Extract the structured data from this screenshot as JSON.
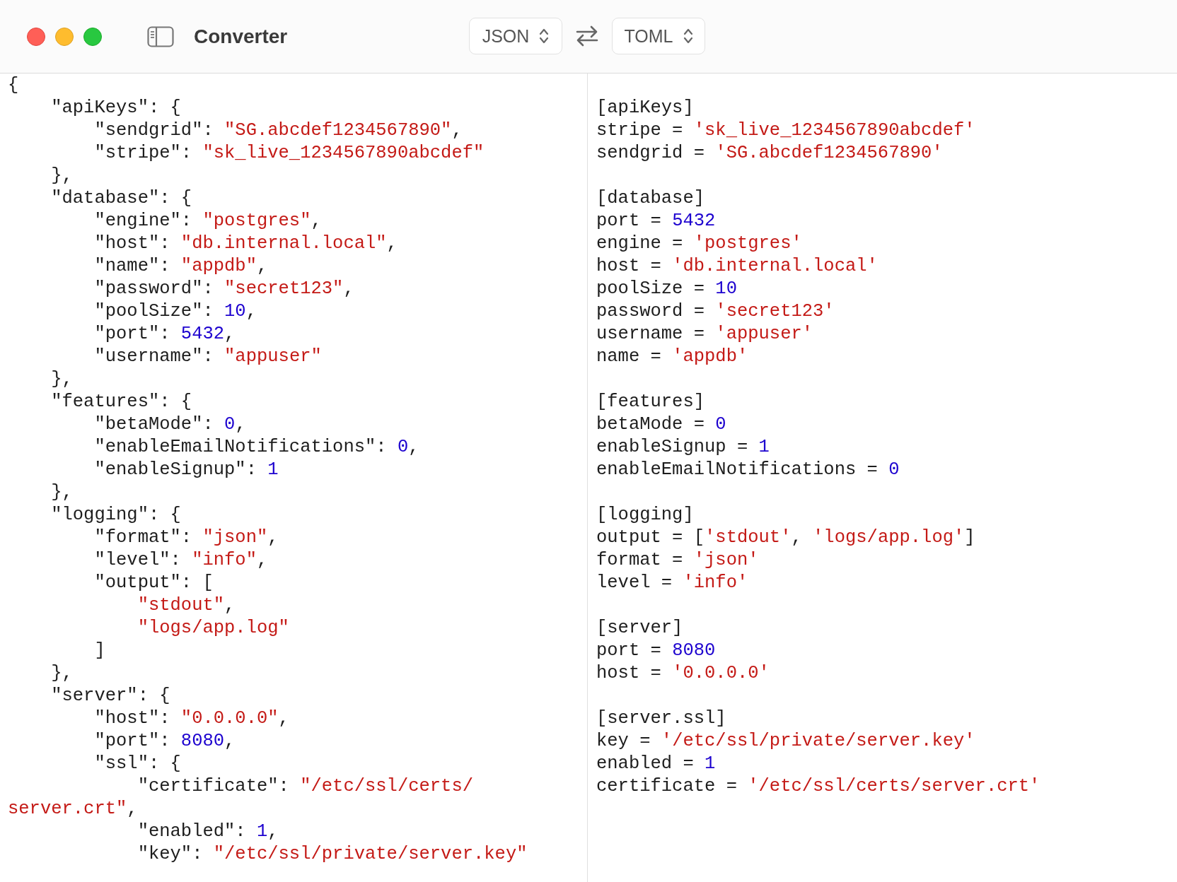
{
  "window": {
    "title": "Converter"
  },
  "toolbar": {
    "source_format": "JSON",
    "target_format": "TOML"
  },
  "input_lines": [
    [
      {
        "kind": "text",
        "text": "{"
      }
    ],
    [
      {
        "kind": "text",
        "text": "    \"apiKeys\": {"
      }
    ],
    [
      {
        "kind": "text",
        "text": "        \"sendgrid\": "
      },
      {
        "kind": "string",
        "text": "\"SG.abcdef1234567890\""
      },
      {
        "kind": "text",
        "text": ","
      }
    ],
    [
      {
        "kind": "text",
        "text": "        \"stripe\": "
      },
      {
        "kind": "string",
        "text": "\"sk_live_1234567890abcdef\""
      }
    ],
    [
      {
        "kind": "text",
        "text": "    },"
      }
    ],
    [
      {
        "kind": "text",
        "text": "    \"database\": {"
      }
    ],
    [
      {
        "kind": "text",
        "text": "        \"engine\": "
      },
      {
        "kind": "string",
        "text": "\"postgres\""
      },
      {
        "kind": "text",
        "text": ","
      }
    ],
    [
      {
        "kind": "text",
        "text": "        \"host\": "
      },
      {
        "kind": "string",
        "text": "\"db.internal.local\""
      },
      {
        "kind": "text",
        "text": ","
      }
    ],
    [
      {
        "kind": "text",
        "text": "        \"name\": "
      },
      {
        "kind": "string",
        "text": "\"appdb\""
      },
      {
        "kind": "text",
        "text": ","
      }
    ],
    [
      {
        "kind": "text",
        "text": "        \"password\": "
      },
      {
        "kind": "string",
        "text": "\"secret123\""
      },
      {
        "kind": "text",
        "text": ","
      }
    ],
    [
      {
        "kind": "text",
        "text": "        \"poolSize\": "
      },
      {
        "kind": "number",
        "text": "10"
      },
      {
        "kind": "text",
        "text": ","
      }
    ],
    [
      {
        "kind": "text",
        "text": "        \"port\": "
      },
      {
        "kind": "number",
        "text": "5432"
      },
      {
        "kind": "text",
        "text": ","
      }
    ],
    [
      {
        "kind": "text",
        "text": "        \"username\": "
      },
      {
        "kind": "string",
        "text": "\"appuser\""
      }
    ],
    [
      {
        "kind": "text",
        "text": "    },"
      }
    ],
    [
      {
        "kind": "text",
        "text": "    \"features\": {"
      }
    ],
    [
      {
        "kind": "text",
        "text": "        \"betaMode\": "
      },
      {
        "kind": "number",
        "text": "0"
      },
      {
        "kind": "text",
        "text": ","
      }
    ],
    [
      {
        "kind": "text",
        "text": "        \"enableEmailNotifications\": "
      },
      {
        "kind": "number",
        "text": "0"
      },
      {
        "kind": "text",
        "text": ","
      }
    ],
    [
      {
        "kind": "text",
        "text": "        \"enableSignup\": "
      },
      {
        "kind": "number",
        "text": "1"
      }
    ],
    [
      {
        "kind": "text",
        "text": "    },"
      }
    ],
    [
      {
        "kind": "text",
        "text": "    \"logging\": {"
      }
    ],
    [
      {
        "kind": "text",
        "text": "        \"format\": "
      },
      {
        "kind": "string",
        "text": "\"json\""
      },
      {
        "kind": "text",
        "text": ","
      }
    ],
    [
      {
        "kind": "text",
        "text": "        \"level\": "
      },
      {
        "kind": "string",
        "text": "\"info\""
      },
      {
        "kind": "text",
        "text": ","
      }
    ],
    [
      {
        "kind": "text",
        "text": "        \"output\": ["
      }
    ],
    [
      {
        "kind": "string",
        "text": "            \"stdout\""
      },
      {
        "kind": "text",
        "text": ","
      }
    ],
    [
      {
        "kind": "string",
        "text": "            \"logs/app.log\""
      }
    ],
    [
      {
        "kind": "text",
        "text": "        ]"
      }
    ],
    [
      {
        "kind": "text",
        "text": "    },"
      }
    ],
    [
      {
        "kind": "text",
        "text": "    \"server\": {"
      }
    ],
    [
      {
        "kind": "text",
        "text": "        \"host\": "
      },
      {
        "kind": "string",
        "text": "\"0.0.0.0\""
      },
      {
        "kind": "text",
        "text": ","
      }
    ],
    [
      {
        "kind": "text",
        "text": "        \"port\": "
      },
      {
        "kind": "number",
        "text": "8080"
      },
      {
        "kind": "text",
        "text": ","
      }
    ],
    [
      {
        "kind": "text",
        "text": "        \"ssl\": {"
      }
    ],
    [
      {
        "kind": "text",
        "text": "            \"certificate\": "
      },
      {
        "kind": "string",
        "text": "\"/etc/ssl/certs/"
      }
    ],
    [
      {
        "kind": "string",
        "text": "server.crt\""
      },
      {
        "kind": "text",
        "text": ","
      }
    ],
    [
      {
        "kind": "text",
        "text": "            \"enabled\": "
      },
      {
        "kind": "number",
        "text": "1"
      },
      {
        "kind": "text",
        "text": ","
      }
    ],
    [
      {
        "kind": "text",
        "text": "            \"key\": "
      },
      {
        "kind": "string",
        "text": "\"/etc/ssl/private/server.key\""
      }
    ]
  ],
  "output_sections": [
    {
      "header": "[apiKeys]",
      "lines": [
        [
          {
            "kind": "text",
            "text": "stripe = "
          },
          {
            "kind": "string",
            "text": "'sk_live_1234567890abcdef'"
          }
        ],
        [
          {
            "kind": "text",
            "text": "sendgrid = "
          },
          {
            "kind": "string",
            "text": "'SG.abcdef1234567890'"
          }
        ]
      ]
    },
    {
      "header": "[database]",
      "lines": [
        [
          {
            "kind": "text",
            "text": "port = "
          },
          {
            "kind": "number",
            "text": "5432"
          }
        ],
        [
          {
            "kind": "text",
            "text": "engine = "
          },
          {
            "kind": "string",
            "text": "'postgres'"
          }
        ],
        [
          {
            "kind": "text",
            "text": "host = "
          },
          {
            "kind": "string",
            "text": "'db.internal.local'"
          }
        ],
        [
          {
            "kind": "text",
            "text": "poolSize = "
          },
          {
            "kind": "number",
            "text": "10"
          }
        ],
        [
          {
            "kind": "text",
            "text": "password = "
          },
          {
            "kind": "string",
            "text": "'secret123'"
          }
        ],
        [
          {
            "kind": "text",
            "text": "username = "
          },
          {
            "kind": "string",
            "text": "'appuser'"
          }
        ],
        [
          {
            "kind": "text",
            "text": "name = "
          },
          {
            "kind": "string",
            "text": "'appdb'"
          }
        ]
      ]
    },
    {
      "header": "[features]",
      "lines": [
        [
          {
            "kind": "text",
            "text": "betaMode = "
          },
          {
            "kind": "number",
            "text": "0"
          }
        ],
        [
          {
            "kind": "text",
            "text": "enableSignup = "
          },
          {
            "kind": "number",
            "text": "1"
          }
        ],
        [
          {
            "kind": "text",
            "text": "enableEmailNotifications = "
          },
          {
            "kind": "number",
            "text": "0"
          }
        ]
      ]
    },
    {
      "header": "[logging]",
      "lines": [
        [
          {
            "kind": "text",
            "text": "output = ["
          },
          {
            "kind": "string",
            "text": "'stdout'"
          },
          {
            "kind": "text",
            "text": ", "
          },
          {
            "kind": "string",
            "text": "'logs/app.log'"
          },
          {
            "kind": "text",
            "text": "]"
          }
        ],
        [
          {
            "kind": "text",
            "text": "format = "
          },
          {
            "kind": "string",
            "text": "'json'"
          }
        ],
        [
          {
            "kind": "text",
            "text": "level = "
          },
          {
            "kind": "string",
            "text": "'info'"
          }
        ]
      ]
    },
    {
      "header": "[server]",
      "lines": [
        [
          {
            "kind": "text",
            "text": "port = "
          },
          {
            "kind": "number",
            "text": "8080"
          }
        ],
        [
          {
            "kind": "text",
            "text": "host = "
          },
          {
            "kind": "string",
            "text": "'0.0.0.0'"
          }
        ]
      ]
    },
    {
      "header": "[server.ssl]",
      "lines": [
        [
          {
            "kind": "text",
            "text": "key = "
          },
          {
            "kind": "string",
            "text": "'/etc/ssl/private/server.key'"
          }
        ],
        [
          {
            "kind": "text",
            "text": "enabled = "
          },
          {
            "kind": "number",
            "text": "1"
          }
        ],
        [
          {
            "kind": "text",
            "text": "certificate = "
          },
          {
            "kind": "string",
            "text": "'/etc/ssl/certs/server.crt'"
          }
        ]
      ]
    }
  ]
}
